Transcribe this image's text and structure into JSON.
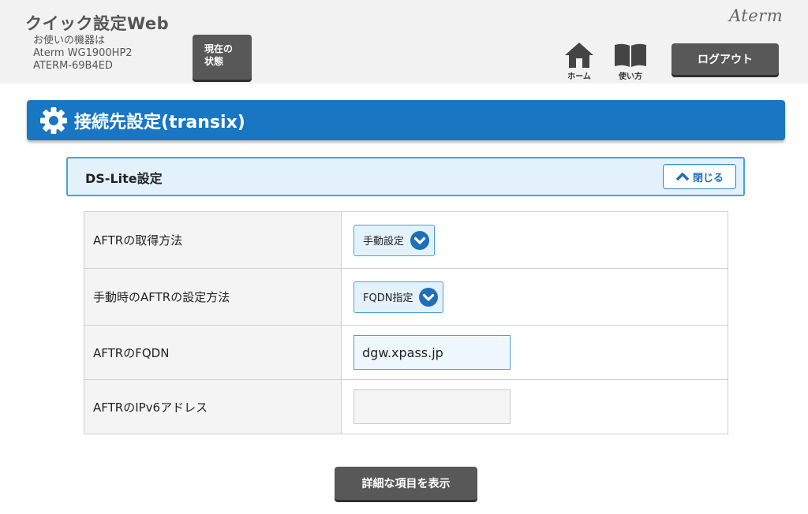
{
  "header": {
    "app_title": "クイック設定Web",
    "device_info": [
      "お使いの機器は",
      "Aterm WG1900HP2",
      "ATERM-69B4ED"
    ],
    "status_button": [
      "現在の",
      "状態"
    ],
    "brand": "Aterm",
    "nav": {
      "home_icon": "home-icon",
      "home_label": "ホーム",
      "help_icon": "book-icon",
      "help_label": "使い方"
    },
    "logout_label": "ログアウト"
  },
  "section": {
    "icon": "gear-icon",
    "title": "接続先設定(transix)"
  },
  "panel": {
    "title": "DS-Lite設定",
    "close_icon": "chevron-up-icon",
    "close_label": "閉じる"
  },
  "rows": [
    {
      "label": "AFTRの取得方法",
      "type": "select",
      "value": "手動設定"
    },
    {
      "label": "手動時のAFTRの設定方法",
      "type": "select",
      "value": "FQDN指定"
    },
    {
      "label": "AFTRのFQDN",
      "type": "input",
      "value": "dgw.xpass.jp"
    },
    {
      "label": "AFTRのIPv6アドレス",
      "type": "input",
      "value": ""
    }
  ],
  "detail_button_label": "詳細な項目を表示",
  "colors": {
    "primary_blue": "#1976c3",
    "panel_bg": "#e3f1fb",
    "panel_border": "#45a2dd",
    "dark_button": "#585858"
  }
}
